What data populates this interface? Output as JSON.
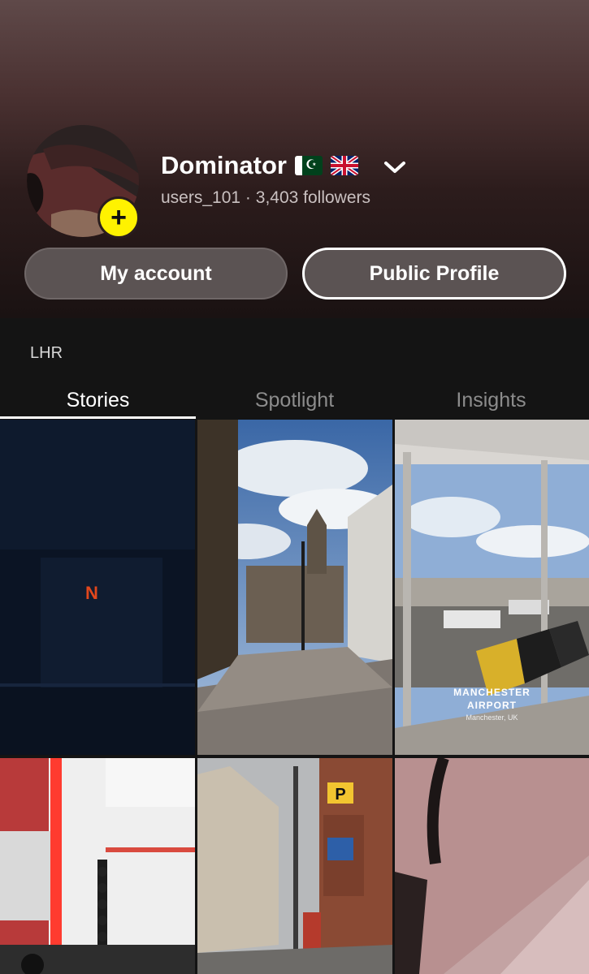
{
  "profile": {
    "display_name": "Dominator",
    "flags": [
      "pakistan-flag",
      "uk-flag"
    ],
    "username": "users_101",
    "separator": "·",
    "followers": "3,403 followers"
  },
  "buttons": {
    "my_account": "My account",
    "public_profile": "Public Profile"
  },
  "section": {
    "location": "LHR"
  },
  "tabs": [
    {
      "label": "Stories",
      "active": true
    },
    {
      "label": "Spotlight",
      "active": false
    },
    {
      "label": "Insights",
      "active": false
    }
  ],
  "stories": [
    {
      "name": "dark-room-netflix-sign"
    },
    {
      "name": "city-street-clock-tower"
    },
    {
      "name": "airport-lounge-window"
    },
    {
      "name": "gym-red-lights"
    },
    {
      "name": "city-street-parking-sign"
    },
    {
      "name": "close-up-photo"
    }
  ],
  "tile_text": {
    "netflix_logo": "N",
    "parking_sign": "P",
    "airport_title_line1": "MANCHESTER",
    "airport_title_line2": "AIRPORT",
    "airport_subtitle": "Manchester, UK"
  },
  "colors": {
    "accent_yellow": "#fff200",
    "header_top": "#5f4949",
    "background": "#141414",
    "tab_inactive": "#8c8c8c"
  }
}
